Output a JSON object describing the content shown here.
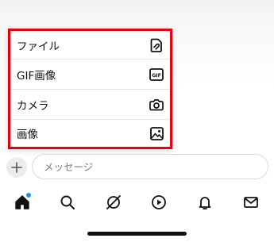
{
  "attach_menu": {
    "items": [
      {
        "label": "ファイル",
        "icon": "file-icon"
      },
      {
        "label": "GIF画像",
        "icon": "gif-icon",
        "icon_text": "GIF"
      },
      {
        "label": "カメラ",
        "icon": "camera-icon"
      },
      {
        "label": "画像",
        "icon": "image-icon"
      }
    ],
    "highlight_color": "#e60012"
  },
  "composer": {
    "plus_icon": "plus-icon",
    "placeholder": "メッセージ"
  },
  "tab_bar": {
    "tabs": [
      {
        "icon": "home-icon",
        "active": true,
        "notification_dot": true
      },
      {
        "icon": "search-icon"
      },
      {
        "icon": "slashed-circle-icon"
      },
      {
        "icon": "play-icon"
      },
      {
        "icon": "bell-icon"
      },
      {
        "icon": "mail-icon"
      }
    ],
    "notification_dot_color": "#1d8fea"
  }
}
